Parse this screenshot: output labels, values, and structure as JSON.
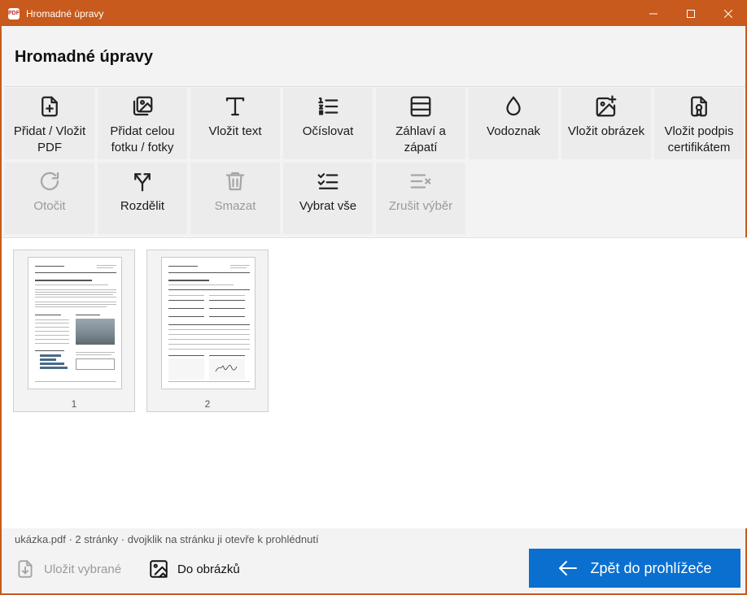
{
  "window": {
    "title": "Hromadné úpravy",
    "app_icon_text": "PDF",
    "controls": [
      "minimize-icon",
      "maximize-icon",
      "close-icon"
    ],
    "accent": "#c75a1c"
  },
  "page_title": "Hromadné úpravy",
  "toolbar": {
    "row1": [
      {
        "id": "add-pdf",
        "label": "Přidat / Vložit PDF",
        "icon": "file-plus-icon",
        "enabled": true
      },
      {
        "id": "add-photo",
        "label": "Přidat celou fotku / fotky",
        "icon": "images-icon",
        "enabled": true
      },
      {
        "id": "insert-text",
        "label": "Vložit text",
        "icon": "text-icon",
        "enabled": true
      },
      {
        "id": "numbering",
        "label": "Očíslovat",
        "icon": "numbered-list-icon",
        "enabled": true
      },
      {
        "id": "header-footer",
        "label": "Záhlaví a zápatí",
        "icon": "header-footer-icon",
        "enabled": true
      },
      {
        "id": "watermark",
        "label": "Vodoznak",
        "icon": "droplet-icon",
        "enabled": true
      },
      {
        "id": "insert-image",
        "label": "Vložit obrázek",
        "icon": "image-plus-icon",
        "enabled": true
      },
      {
        "id": "cert-sign",
        "label": "Vložit podpis certifikátem",
        "icon": "certificate-icon",
        "enabled": true
      }
    ],
    "row2": [
      {
        "id": "rotate",
        "label": "Otočit",
        "icon": "rotate-icon",
        "enabled": false
      },
      {
        "id": "split",
        "label": "Rozdělit",
        "icon": "split-icon",
        "enabled": true
      },
      {
        "id": "delete",
        "label": "Smazat",
        "icon": "trash-icon",
        "enabled": false
      },
      {
        "id": "select-all",
        "label": "Vybrat vše",
        "icon": "checklist-icon",
        "enabled": true
      },
      {
        "id": "deselect",
        "label": "Zrušit výběr",
        "icon": "list-x-icon",
        "enabled": false
      }
    ]
  },
  "pages": [
    {
      "number": "1"
    },
    {
      "number": "2"
    }
  ],
  "status": "ukázka.pdf · 2 stránky · dvojklik na stránku ji otevře k prohlédnutí",
  "footer": {
    "save_selected": {
      "label": "Uložit vybrané",
      "icon": "save-download-icon",
      "enabled": false
    },
    "to_images": {
      "label": "Do obrázků",
      "icon": "export-image-icon",
      "enabled": true
    },
    "back": {
      "label": "Zpět do prohlížeče",
      "icon": "arrow-left-icon",
      "color": "#0a6fcf"
    }
  }
}
